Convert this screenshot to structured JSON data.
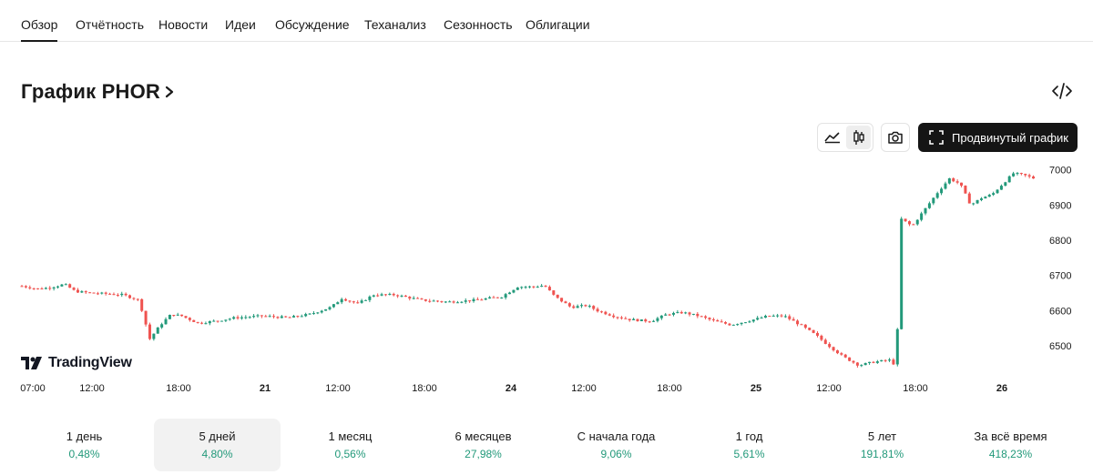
{
  "tabs": [
    {
      "label": "Обзор",
      "active": true
    },
    {
      "label": "Отчётность",
      "active": false
    },
    {
      "label": "Новости",
      "active": false
    },
    {
      "label": "Идеи",
      "active": false
    },
    {
      "label": "Обсуждение",
      "active": false
    },
    {
      "label": "Теханализ",
      "active": false
    },
    {
      "label": "Сезонность",
      "active": false
    },
    {
      "label": "Облигации",
      "active": false
    }
  ],
  "header": {
    "title": "График PHOR",
    "embed_icon": "code-icon",
    "chevron_icon": "chevron-right-icon"
  },
  "toolbar": {
    "line_chart_icon": "area-chart-icon",
    "candle_chart_icon": "candlestick-icon",
    "active_chart_type": "candles",
    "screenshot_icon": "camera-icon",
    "advanced_label": "Продвинутый график",
    "advanced_icon": "expand-icon"
  },
  "brand": {
    "name": "TradingView",
    "logo_icon": "tradingview-logo"
  },
  "colors": {
    "up": "#22997a",
    "down": "#ef5350",
    "accent_dark": "#151515",
    "positive_text": "#22997a"
  },
  "chart_data": {
    "type": "candlestick",
    "title": "",
    "y_ticks": [
      6500,
      6600,
      6700,
      6800,
      6900,
      7000
    ],
    "ylim": [
      6410,
      7030
    ],
    "y_axis_position": "right",
    "x_ticks": [
      "07:00",
      "12:00",
      "18:00",
      "21",
      "12:00",
      "18:00",
      "24",
      "12:00",
      "18:00",
      "25",
      "12:00",
      "18:00",
      "26"
    ],
    "grid": false,
    "points": [
      {
        "x": 0,
        "y": 6670
      },
      {
        "x": 3,
        "y": 6662
      },
      {
        "x": 5,
        "y": 6665
      },
      {
        "x": 8,
        "y": 6675
      },
      {
        "x": 10,
        "y": 6655
      },
      {
        "x": 13,
        "y": 6650
      },
      {
        "x": 16,
        "y": 6648
      },
      {
        "x": 19,
        "y": 6645
      },
      {
        "x": 22,
        "y": 6630
      },
      {
        "x": 24,
        "y": 6520
      },
      {
        "x": 26,
        "y": 6560
      },
      {
        "x": 28,
        "y": 6590
      },
      {
        "x": 30,
        "y": 6585
      },
      {
        "x": 33,
        "y": 6565
      },
      {
        "x": 36,
        "y": 6570
      },
      {
        "x": 40,
        "y": 6580
      },
      {
        "x": 45,
        "y": 6585
      },
      {
        "x": 50,
        "y": 6580
      },
      {
        "x": 54,
        "y": 6590
      },
      {
        "x": 58,
        "y": 6610
      },
      {
        "x": 60,
        "y": 6635
      },
      {
        "x": 63,
        "y": 6620
      },
      {
        "x": 66,
        "y": 6645
      },
      {
        "x": 70,
        "y": 6645
      },
      {
        "x": 75,
        "y": 6630
      },
      {
        "x": 80,
        "y": 6625
      },
      {
        "x": 85,
        "y": 6630
      },
      {
        "x": 90,
        "y": 6640
      },
      {
        "x": 93,
        "y": 6668
      },
      {
        "x": 96,
        "y": 6668
      },
      {
        "x": 98,
        "y": 6672
      },
      {
        "x": 100,
        "y": 6640
      },
      {
        "x": 103,
        "y": 6610
      },
      {
        "x": 106,
        "y": 6615
      },
      {
        "x": 108,
        "y": 6600
      },
      {
        "x": 111,
        "y": 6585
      },
      {
        "x": 114,
        "y": 6575
      },
      {
        "x": 118,
        "y": 6570
      },
      {
        "x": 121,
        "y": 6590
      },
      {
        "x": 124,
        "y": 6595
      },
      {
        "x": 127,
        "y": 6585
      },
      {
        "x": 130,
        "y": 6570
      },
      {
        "x": 133,
        "y": 6560
      },
      {
        "x": 136,
        "y": 6570
      },
      {
        "x": 140,
        "y": 6585
      },
      {
        "x": 143,
        "y": 6585
      },
      {
        "x": 146,
        "y": 6560
      },
      {
        "x": 149,
        "y": 6530
      },
      {
        "x": 151,
        "y": 6505
      },
      {
        "x": 154,
        "y": 6470
      },
      {
        "x": 157,
        "y": 6445
      },
      {
        "x": 160,
        "y": 6455
      },
      {
        "x": 163,
        "y": 6460
      },
      {
        "x": 164,
        "y": 6440
      },
      {
        "x": 165,
        "y": 6860
      },
      {
        "x": 167,
        "y": 6840
      },
      {
        "x": 170,
        "y": 6900
      },
      {
        "x": 172,
        "y": 6940
      },
      {
        "x": 174,
        "y": 6975
      },
      {
        "x": 176,
        "y": 6960
      },
      {
        "x": 178,
        "y": 6900
      },
      {
        "x": 180,
        "y": 6920
      },
      {
        "x": 182,
        "y": 6930
      },
      {
        "x": 184,
        "y": 6960
      },
      {
        "x": 186,
        "y": 6990
      },
      {
        "x": 188,
        "y": 6985
      },
      {
        "x": 190,
        "y": 6975
      }
    ]
  },
  "periods": [
    {
      "label": "1 день",
      "value": "0,48%",
      "active": false
    },
    {
      "label": "5 дней",
      "value": "4,80%",
      "active": true
    },
    {
      "label": "1 месяц",
      "value": "0,56%",
      "active": false
    },
    {
      "label": "6 месяцев",
      "value": "27,98%",
      "active": false
    },
    {
      "label": "С начала года",
      "value": "9,06%",
      "active": false
    },
    {
      "label": "1 год",
      "value": "5,61%",
      "active": false
    },
    {
      "label": "5 лет",
      "value": "191,81%",
      "active": false
    },
    {
      "label": "За всё время",
      "value": "418,23%",
      "active": false
    }
  ]
}
